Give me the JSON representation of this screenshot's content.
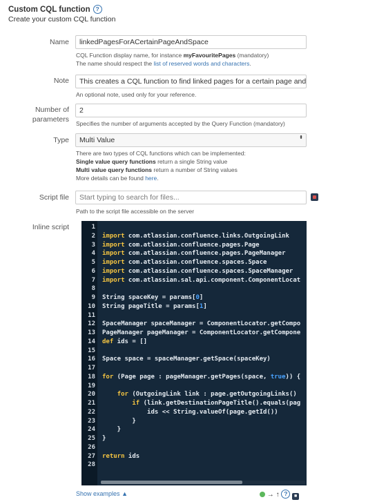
{
  "header": {
    "title": "Custom CQL function",
    "help_icon": "help-circle-icon",
    "subtitle": "Create your custom CQL function"
  },
  "form": {
    "name": {
      "label": "Name",
      "value": "linkedPagesForACertainPageAndSpace",
      "help_line1_prefix": "CQL Function display name, for instance ",
      "help_line1_bold": "myFavouritePages",
      "help_line1_suffix": " (mandatory)",
      "help_line2_prefix": "The name should respect the ",
      "help_line2_link": "list of reserved words and characters",
      "help_line2_suffix": "."
    },
    "note": {
      "label": "Note",
      "value": "This creates a CQL function to find linked pages for a certain page and space",
      "help": "An optional note, used only for your reference."
    },
    "params": {
      "label_line1": "Number of",
      "label_line2": "parameters",
      "value": "2",
      "help": "Specifies the number of arguments accepted by the Query Function (mandatory)"
    },
    "type": {
      "label": "Type",
      "value": "Multi Value",
      "arrow": "⬍",
      "help_line1": "There are two types of CQL functions which can be implemented:",
      "help_line2_bold": "Single value query functions",
      "help_line2_rest": " return a single String value",
      "help_line3_bold": "Multi value query functions",
      "help_line3_rest": " return a number of String values",
      "help_line4_prefix": "More details can be found ",
      "help_line4_link": "here",
      "help_line4_suffix": "."
    },
    "script_file": {
      "label": "Script file",
      "placeholder": "Start typing to search for files...",
      "help": "Path to the script file accessible on the server",
      "picker_icon": "file-picker-icon"
    },
    "inline_script": {
      "label": "Inline script",
      "lines": [
        {
          "n": "1",
          "segs": []
        },
        {
          "n": "2",
          "segs": [
            {
              "t": "import",
              "c": "kw"
            },
            {
              "t": " com.atlassian.confluence.links.OutgoingLink",
              "c": ""
            }
          ]
        },
        {
          "n": "3",
          "segs": [
            {
              "t": "import",
              "c": "kw"
            },
            {
              "t": " com.atlassian.confluence.pages.Page",
              "c": ""
            }
          ]
        },
        {
          "n": "4",
          "segs": [
            {
              "t": "import",
              "c": "kw"
            },
            {
              "t": " com.atlassian.confluence.pages.PageManager",
              "c": ""
            }
          ]
        },
        {
          "n": "5",
          "segs": [
            {
              "t": "import",
              "c": "kw"
            },
            {
              "t": " com.atlassian.confluence.spaces.Space",
              "c": ""
            }
          ]
        },
        {
          "n": "6",
          "segs": [
            {
              "t": "import",
              "c": "kw"
            },
            {
              "t": " com.atlassian.confluence.spaces.SpaceManager",
              "c": ""
            }
          ]
        },
        {
          "n": "7",
          "segs": [
            {
              "t": "import",
              "c": "kw"
            },
            {
              "t": " com.atlassian.sal.api.component.ComponentLocat",
              "c": ""
            }
          ]
        },
        {
          "n": "8",
          "segs": []
        },
        {
          "n": "9",
          "segs": [
            {
              "t": "String spaceKey = params[",
              "c": ""
            },
            {
              "t": "0",
              "c": "lit"
            },
            {
              "t": "]",
              "c": ""
            }
          ]
        },
        {
          "n": "10",
          "segs": [
            {
              "t": "String pageTitle = params[",
              "c": ""
            },
            {
              "t": "1",
              "c": "lit"
            },
            {
              "t": "]",
              "c": ""
            }
          ]
        },
        {
          "n": "11",
          "segs": []
        },
        {
          "n": "12",
          "segs": [
            {
              "t": "SpaceManager spaceManager = ComponentLocator.getCompo",
              "c": ""
            }
          ]
        },
        {
          "n": "13",
          "segs": [
            {
              "t": "PageManager pageManager = ComponentLocator.getCompone",
              "c": ""
            }
          ]
        },
        {
          "n": "14",
          "segs": [
            {
              "t": "def",
              "c": "kw"
            },
            {
              "t": " ids = []",
              "c": ""
            }
          ]
        },
        {
          "n": "15",
          "segs": []
        },
        {
          "n": "16",
          "segs": [
            {
              "t": "Space space = spaceManager.getSpace(spaceKey)",
              "c": ""
            }
          ]
        },
        {
          "n": "17",
          "segs": []
        },
        {
          "n": "18",
          "segs": [
            {
              "t": "for",
              "c": "kw"
            },
            {
              "t": " (Page page : pageManager.getPages(space, ",
              "c": ""
            },
            {
              "t": "true",
              "c": "lit"
            },
            {
              "t": ")) {",
              "c": ""
            }
          ]
        },
        {
          "n": "19",
          "segs": []
        },
        {
          "n": "20",
          "segs": [
            {
              "t": "    ",
              "c": ""
            },
            {
              "t": "for",
              "c": "kw"
            },
            {
              "t": " (OutgoingLink link : page.getOutgoingLinks()",
              "c": ""
            }
          ]
        },
        {
          "n": "21",
          "segs": [
            {
              "t": "        ",
              "c": ""
            },
            {
              "t": "if",
              "c": "kw"
            },
            {
              "t": " (link.getDestinationPageTitle().equals(pag",
              "c": ""
            }
          ]
        },
        {
          "n": "22",
          "segs": [
            {
              "t": "            ids << String.valueOf(page.getId())",
              "c": ""
            }
          ]
        },
        {
          "n": "23",
          "segs": [
            {
              "t": "        }",
              "c": ""
            }
          ]
        },
        {
          "n": "24",
          "segs": [
            {
              "t": "    }",
              "c": ""
            }
          ]
        },
        {
          "n": "25",
          "segs": [
            {
              "t": "}",
              "c": ""
            }
          ]
        },
        {
          "n": "26",
          "segs": []
        },
        {
          "n": "27",
          "segs": [
            {
              "t": "return",
              "c": "kw"
            },
            {
              "t": " ids",
              "c": ""
            }
          ]
        },
        {
          "n": "28",
          "segs": []
        }
      ]
    }
  },
  "footer": {
    "show_examples": "Show examples",
    "show_examples_icon": "double-chevron-up-icon",
    "icons": [
      "status-ok-icon",
      "arrow-right-icon",
      "arrow-up-icon",
      "help-circle-icon",
      "script-tool-icon"
    ]
  },
  "colors": {
    "editor_bg": "#15283a",
    "keyword": "#f5c542",
    "literal": "#4aa3ff",
    "link": "#3572b0"
  }
}
